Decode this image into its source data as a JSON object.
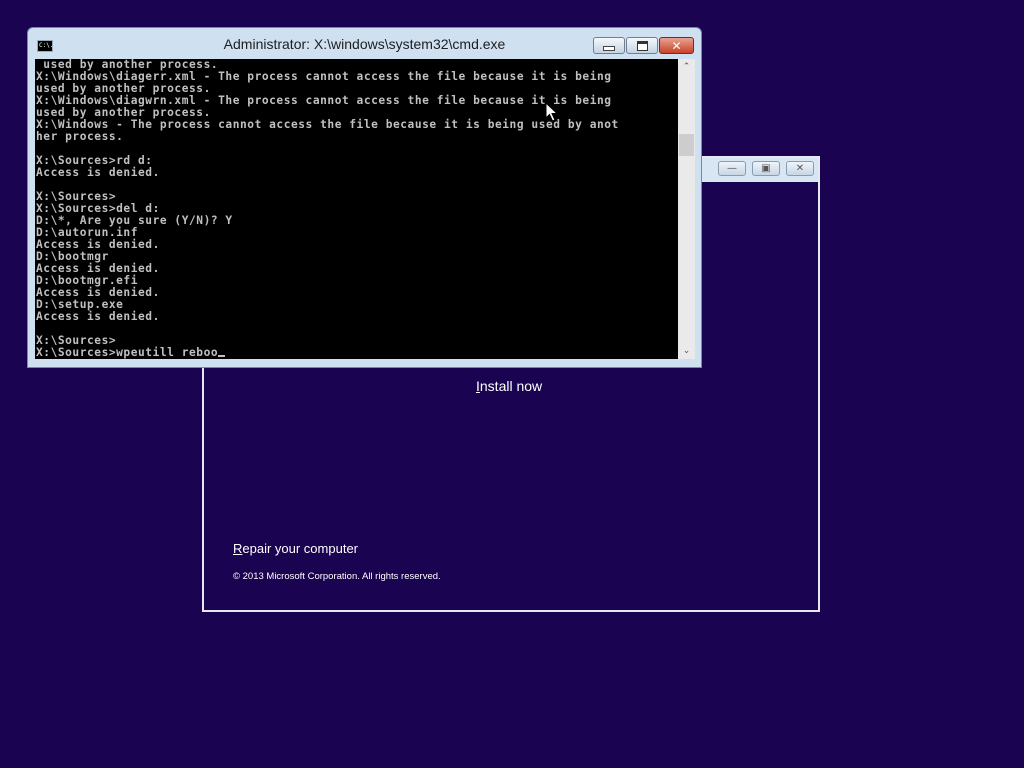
{
  "cmd_window": {
    "title": "Administrator: X:\\windows\\system32\\cmd.exe",
    "icon_text": "C:\\.",
    "lines": [
      " used by another process.",
      "X:\\Windows\\diagerr.xml - The process cannot access the file because it is being",
      "used by another process.",
      "X:\\Windows\\diagwrn.xml - The process cannot access the file because it is being",
      "used by another process.",
      "X:\\Windows - The process cannot access the file because it is being used by anot",
      "her process.",
      "",
      "X:\\Sources>rd d:",
      "Access is denied.",
      "",
      "X:\\Sources>",
      "X:\\Sources>del d:",
      "D:\\*, Are you sure (Y/N)? Y",
      "D:\\autorun.inf",
      "Access is denied.",
      "D:\\bootmgr",
      "Access is denied.",
      "D:\\bootmgr.efi",
      "Access is denied.",
      "D:\\setup.exe",
      "Access is denied.",
      "",
      "X:\\Sources>"
    ],
    "current_input": "X:\\Sources>wpeutill reboo"
  },
  "setup_window": {
    "install_now": "Install now",
    "repair_link": "Repair your computer",
    "copyright": "© 2013 Microsoft Corporation. All rights reserved."
  },
  "colors": {
    "desktop_bg": "#1a0350",
    "console_bg": "#000000",
    "console_text": "#c0c0c0",
    "close_button": "#c7432a"
  }
}
